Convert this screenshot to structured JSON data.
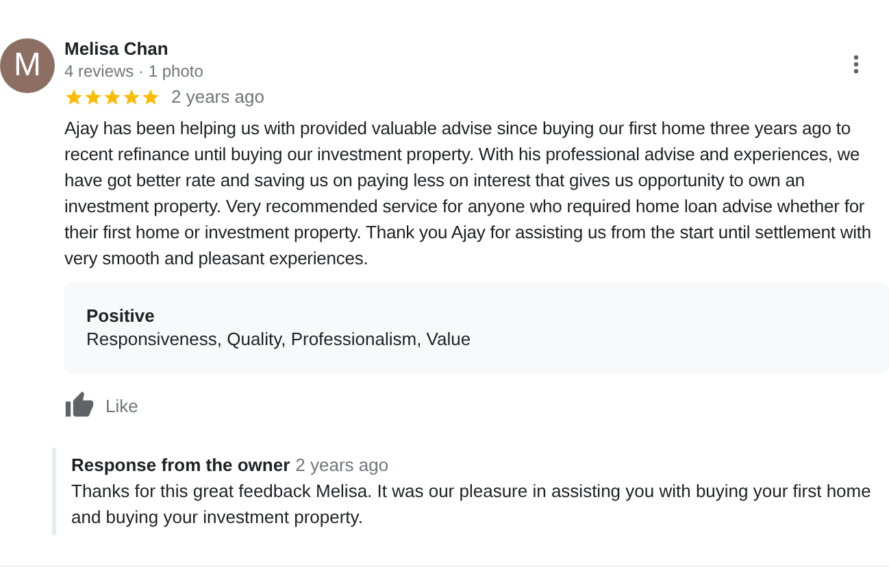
{
  "review": {
    "author": "Melisa Chan",
    "avatar_letter": "M",
    "meta": "4 reviews · 1 photo",
    "stars": 5,
    "time": "2 years ago",
    "text": "Ajay has been helping us with provided valuable advise since buying our first home three years ago to recent refinance until buying our investment property. With his professional advise and experiences, we have got better rate and saving us on paying less on interest that gives us opportunity to own an investment property. Very recommended service for anyone who required home loan advise whether for their first home or investment property. Thank you Ajay for assisting us from the start until settlement with very smooth and pleasant experiences.",
    "highlights": {
      "title": "Positive",
      "text": "Responsiveness, Quality, Professionalism, Value"
    },
    "like_label": "Like",
    "owner_response": {
      "title": "Response from the owner",
      "time": "2 years ago",
      "text": "Thanks for this great feedback Melisa. It was our pleasure in assisting you with buying your first home and buying your investment property."
    }
  }
}
